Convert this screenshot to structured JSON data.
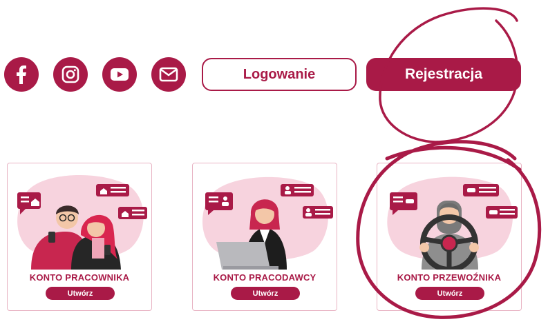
{
  "colors": {
    "brand": "#a91a47",
    "card_border": "#e8b3c3",
    "blob": "#f7d3de"
  },
  "social": [
    {
      "name": "facebook-icon"
    },
    {
      "name": "instagram-icon"
    },
    {
      "name": "youtube-icon"
    },
    {
      "name": "mail-icon"
    }
  ],
  "header": {
    "login_label": "Logowanie",
    "register_label": "Rejestracja"
  },
  "cards": [
    {
      "title": "KONTO PRACOWNIKA",
      "button": "Utwórz",
      "illustration": "workers-icon"
    },
    {
      "title": "KONTO PRACODAWCY",
      "button": "Utwórz",
      "illustration": "employer-icon"
    },
    {
      "title": "KONTO PRZEWOŹNIKA",
      "button": "Utwórz",
      "illustration": "driver-icon"
    }
  ]
}
